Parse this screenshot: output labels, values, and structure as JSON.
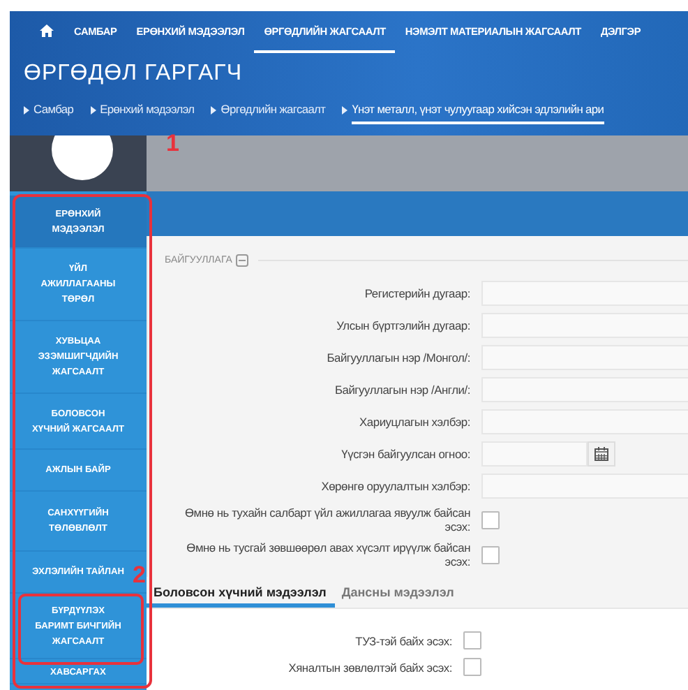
{
  "nav": {
    "items": [
      {
        "kind": "home",
        "selected": false
      },
      {
        "kind": "text",
        "label": "САМБАР",
        "selected": false
      },
      {
        "kind": "text",
        "label": "ЕРӨНХИЙ МЭДЭЭЛЭЛ",
        "selected": false
      },
      {
        "kind": "text",
        "label": "ӨРГӨДЛИЙН ЖАГСААЛТ",
        "selected": true
      },
      {
        "kind": "text",
        "label": "НЭМЭЛТ МАТЕРИАЛЫН ЖАГСААЛТ",
        "selected": false
      },
      {
        "kind": "text",
        "label": "ДЭЛГЭР",
        "selected": false
      }
    ]
  },
  "page_title": "ӨРГӨДӨЛ ГАРГАГЧ",
  "breadcrumb": [
    {
      "label": "Самбар",
      "selected": false
    },
    {
      "label": "Ерөнхий мэдээлэл",
      "selected": false
    },
    {
      "label": "Өргөдлийн жагсаалт",
      "selected": false
    },
    {
      "label": "Үнэт металл, үнэт чулуугаар хийсэн эдлэлийн ари",
      "selected": true
    }
  ],
  "sidebar": {
    "annotation": "1",
    "items": [
      {
        "label": "ЕРӨНХИЙ МЭДЭЭЛЭЛ",
        "selected": true
      },
      {
        "label": "ҮЙЛ АЖИЛЛАГААНЫ ТӨРӨЛ",
        "selected": false
      },
      {
        "label": "ХУВЬЦАА ЭЗЭМШИГЧДИЙН ЖАГСААЛТ",
        "selected": false
      },
      {
        "label": "БОЛОВСОН ХҮЧНИЙ ЖАГСААЛТ",
        "selected": false
      },
      {
        "label": "АЖЛЫН БАЙР",
        "selected": false
      },
      {
        "label": "САНХҮҮГИЙН ТӨЛӨВЛӨЛТ",
        "selected": false
      },
      {
        "label": "ЭХЛЭЛИЙН ТАЙЛАН",
        "selected": false
      },
      {
        "label": "БҮРДҮҮЛЭХ БАРИМТ БИЧГИЙН ЖАГСААЛТ",
        "selected": false,
        "annotation": "2"
      },
      {
        "label": "ХАВСАРГАХ",
        "selected": false
      }
    ]
  },
  "organization": {
    "heading": "БАЙГУУЛЛАГА",
    "expanded": true,
    "fields": [
      {
        "kind": "text",
        "label": "Регистерийн дугаар:"
      },
      {
        "kind": "text",
        "label": "Улсын бүртгэлийн дугаар:"
      },
      {
        "kind": "text",
        "label": "Байгууллагын нэр /Монгол/:"
      },
      {
        "kind": "text",
        "label": "Байгууллагын нэр /Англи/:"
      },
      {
        "kind": "text",
        "label": "Хариуцлагын хэлбэр:"
      },
      {
        "kind": "date",
        "label": "Үүсгэн байгуулсан огноо:"
      },
      {
        "kind": "text",
        "label": "Хөрөнгө оруулалтын хэлбэр:"
      },
      {
        "kind": "checkbox",
        "label": "Өмнө нь тухайн салбарт үйл ажиллагаа явуулж байсан эсэх:",
        "checked": false
      },
      {
        "kind": "checkbox",
        "label": "Өмнө нь тусгай зөвшөөрөл авах хүсэлт ирүүлж байсан эсэх:",
        "checked": false
      }
    ]
  },
  "tabs": [
    {
      "label": "Боловсон хүчний мэдээлэл",
      "selected": true
    },
    {
      "label": "Дансны мэдээлэл",
      "selected": false
    }
  ],
  "tab_fields": [
    {
      "kind": "checkbox",
      "label": "ТУЗ-тэй байх эсэх:",
      "checked": false
    },
    {
      "kind": "checkbox",
      "label": "Хяналтын зөвлөлтэй байх эсэх:",
      "checked": false
    }
  ]
}
